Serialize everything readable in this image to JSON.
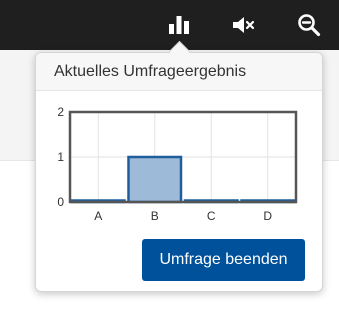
{
  "topbar": {
    "icons": [
      "bar-chart-icon",
      "mute-icon",
      "zoom-out-icon"
    ]
  },
  "popover": {
    "title": "Aktuelles Umfrageergebnis",
    "end_button_label": "Umfrage beenden"
  },
  "chart_data": {
    "type": "bar",
    "categories": [
      "A",
      "B",
      "C",
      "D"
    ],
    "values": [
      0,
      1,
      0,
      0
    ],
    "ylim": [
      0,
      2
    ],
    "yticks": [
      "0",
      "1",
      "2"
    ],
    "grid": true,
    "colors": {
      "bar_fill": "#9dbad8",
      "bar_stroke": "#1f5e9c",
      "frame": "#555555",
      "grid": "#e2e2e2"
    }
  }
}
